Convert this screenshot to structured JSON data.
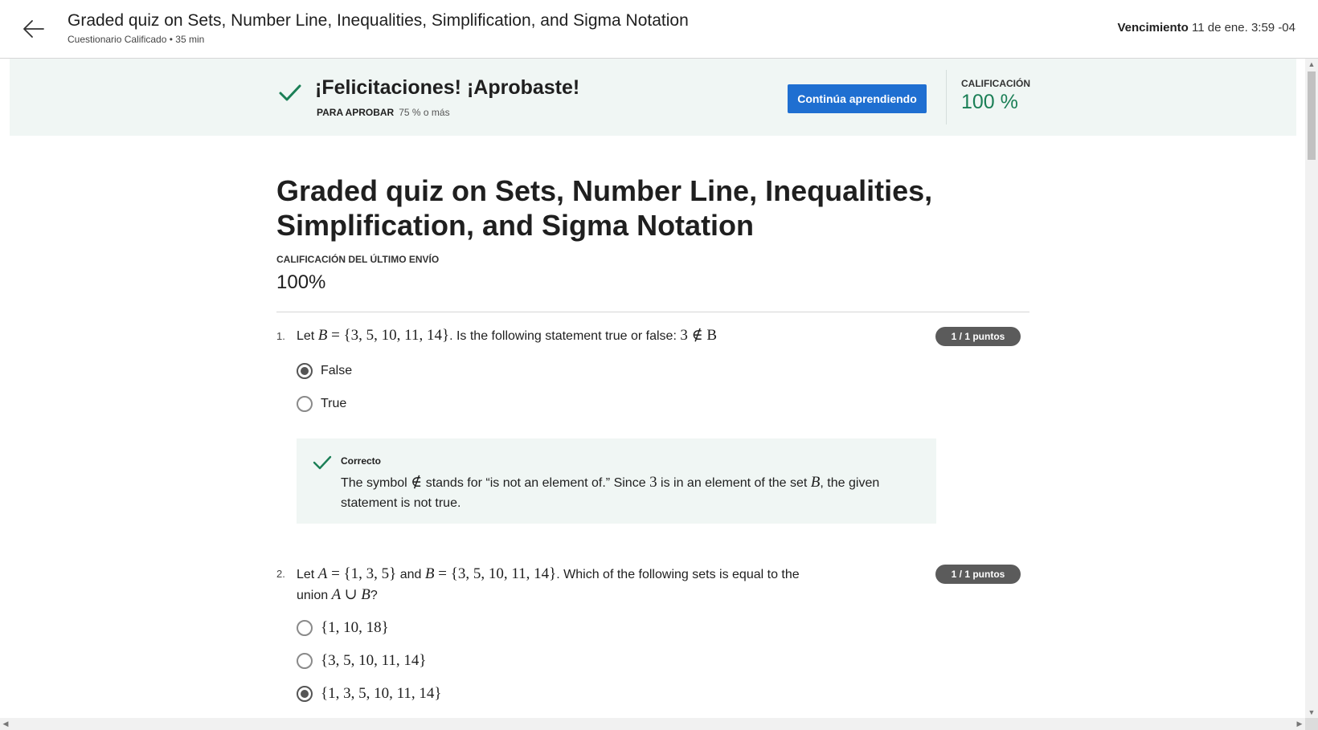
{
  "header": {
    "title": "Graded quiz on Sets, Number Line, Inequalities, Simplification, and Sigma Notation",
    "subtitle": "Cuestionario Calificado • 35 min",
    "due_label": "Vencimiento",
    "due_value": "11 de ene. 3:59 -04"
  },
  "banner": {
    "congrats": "¡Felicitaciones! ¡Aprobaste!",
    "pass_label": "PARA APROBAR",
    "pass_value": "75 % o más",
    "continue_button": "Continúa aprendiendo",
    "grade_label": "CALIFICACIÓN",
    "grade_value": "100 %"
  },
  "main": {
    "title": "Graded quiz on Sets, Number Line, Inequalities, Simplification, and Sigma Notation",
    "last_submission_label": "CALIFICACIÓN DEL ÚLTIMO ENVÍO",
    "last_submission_value": "100%"
  },
  "questions": [
    {
      "number": "1.",
      "text_let": "Let",
      "text_mid": ". Is the following statement true or false:",
      "set_B": "{3, 5, 10, 11, 14}",
      "statement": "3 ∉ B",
      "points": "1 / 1 puntos",
      "options": [
        {
          "label": "False",
          "selected": true
        },
        {
          "label": "True",
          "selected": false
        }
      ],
      "feedback": {
        "title": "Correcto",
        "text_1": "The symbol",
        "symbol": "∉",
        "text_2": "stands for “is not an element of.” Since",
        "three": "3",
        "text_3": "is in an element of the set",
        "setname": "B",
        "text_4": ", the given statement is not true."
      }
    },
    {
      "number": "2.",
      "text_let": "Let",
      "set_A": "{1, 3, 5}",
      "text_and": "and",
      "set_B": "{3, 5, 10, 11, 14}",
      "text_mid": ". Which of the following sets is equal to the union",
      "union": "A ∪ B",
      "text_end": "?",
      "points": "1 / 1 puntos",
      "options": [
        {
          "label": "{1, 10, 18}",
          "selected": false
        },
        {
          "label": "{3, 5, 10, 11, 14}",
          "selected": false
        },
        {
          "label": "{1, 3, 5, 10, 11, 14}",
          "selected": true
        }
      ]
    }
  ],
  "colors": {
    "accent_blue": "#1f6fd1",
    "success_green": "#1b7f56",
    "banner_bg": "#f0f6f4"
  },
  "icons": {
    "back": "arrow-left-icon",
    "check": "checkmark-icon"
  }
}
